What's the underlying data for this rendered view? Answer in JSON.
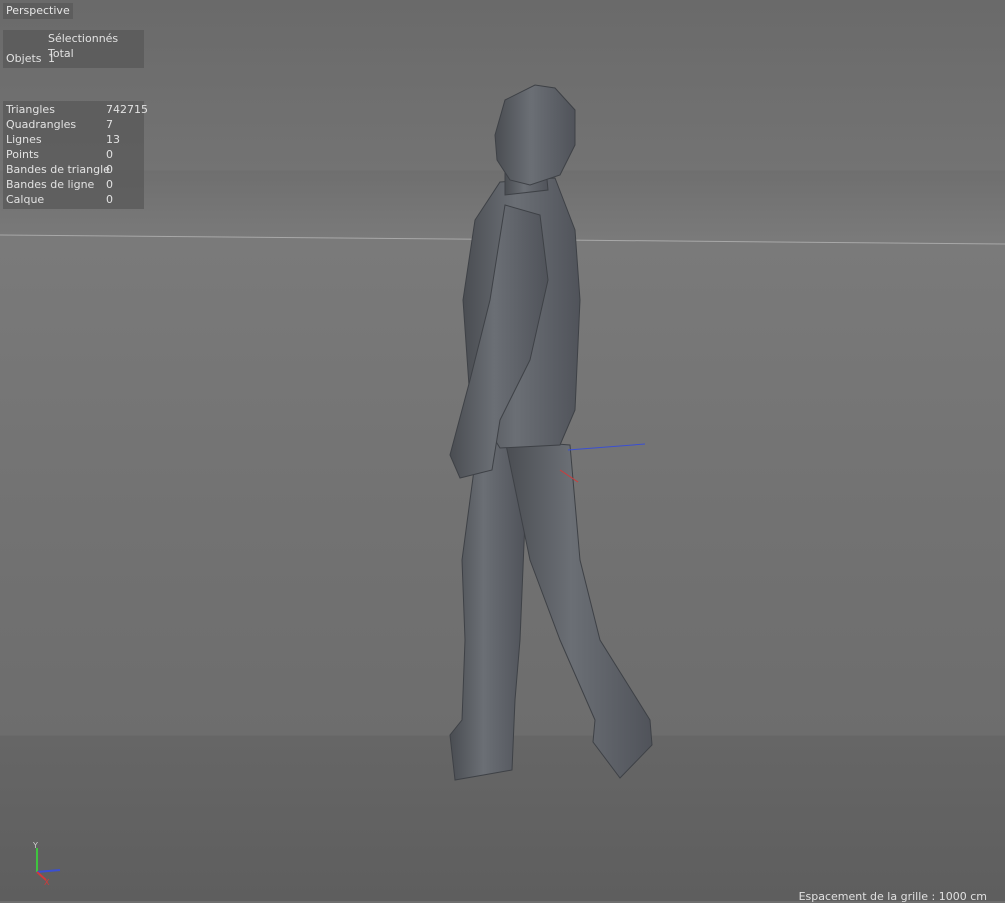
{
  "viewport": {
    "label": "Perspective"
  },
  "selection_panel": {
    "col_selected": "Sélectionnés",
    "col_total": "Total",
    "row_label": "Objets",
    "row_value": "1"
  },
  "stats_panel": {
    "rows": [
      {
        "label": "Triangles",
        "value": "742715"
      },
      {
        "label": "Quadrangles",
        "value": "7"
      },
      {
        "label": "Lignes",
        "value": "13"
      },
      {
        "label": "Points",
        "value": "0"
      },
      {
        "label": "Bandes de triangle",
        "value": "0"
      },
      {
        "label": "Bandes de ligne",
        "value": "0"
      },
      {
        "label": "Calque",
        "value": "0"
      }
    ]
  },
  "axis_gizmo": {
    "y_label": "Y",
    "x_label": "X"
  },
  "footer": {
    "grid_spacing": "Espacement de la grille : 1000 cm"
  },
  "colors": {
    "axis_x": "#d23a3a",
    "axis_y": "#3fc43f",
    "axis_z": "#3a4fd2",
    "model": "#5d6066"
  }
}
